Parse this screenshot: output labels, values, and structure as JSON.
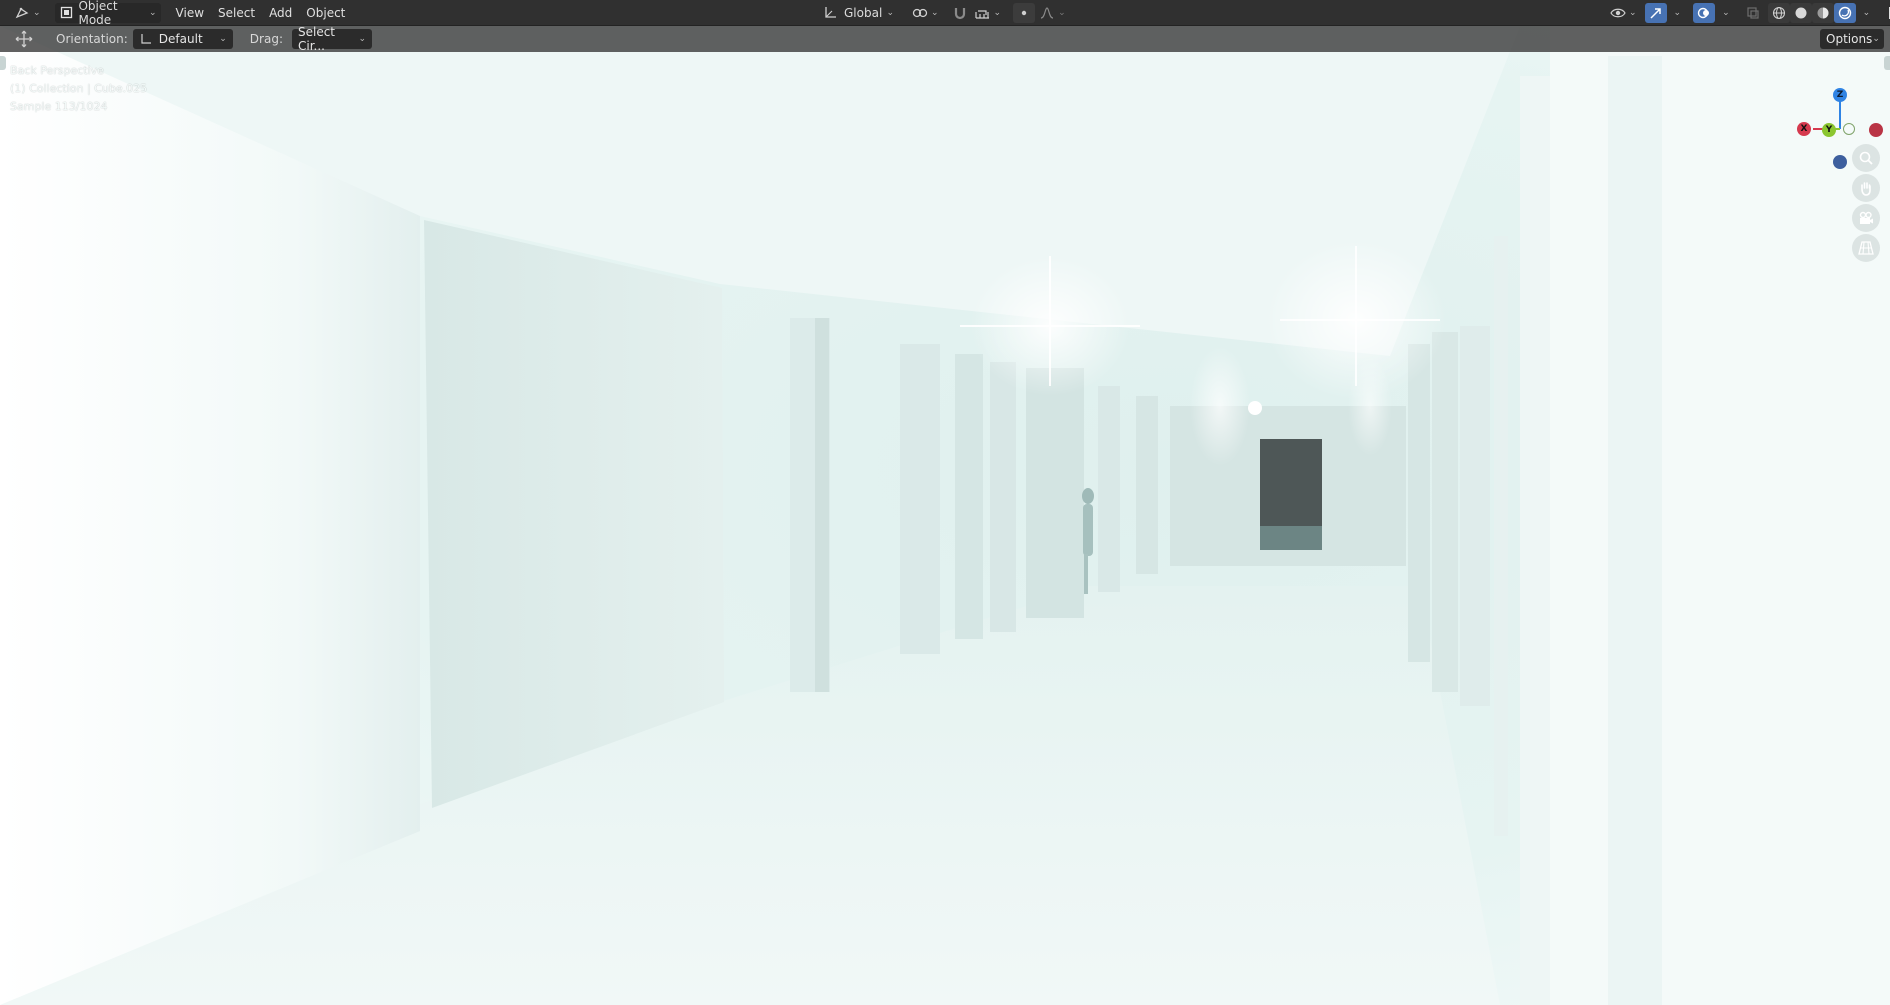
{
  "header": {
    "mode_label": "Object Mode",
    "menus": [
      "View",
      "Select",
      "Add",
      "Object"
    ],
    "orientation_label": "Global"
  },
  "toolbar": {
    "orientation_label": "Orientation:",
    "orientation_value": "Default",
    "drag_label": "Drag:",
    "drag_value": "Select Cir...",
    "options_label": "Options"
  },
  "viewport": {
    "view_name": "Back Perspective",
    "collection": "(1) Collection | Cube.025",
    "sample": "Sample 113/1024"
  },
  "gizmo": {
    "x_label": "X",
    "y_label": "Y",
    "z_label": "Z",
    "colors": {
      "x": "#d5394e",
      "y": "#8bc630",
      "z": "#2f83e4",
      "neg_y": "#3d5f9e"
    }
  },
  "colors": {
    "header_bg": "#303030",
    "accent": "#4772b3",
    "scene_bg": "#eaf6f4"
  }
}
